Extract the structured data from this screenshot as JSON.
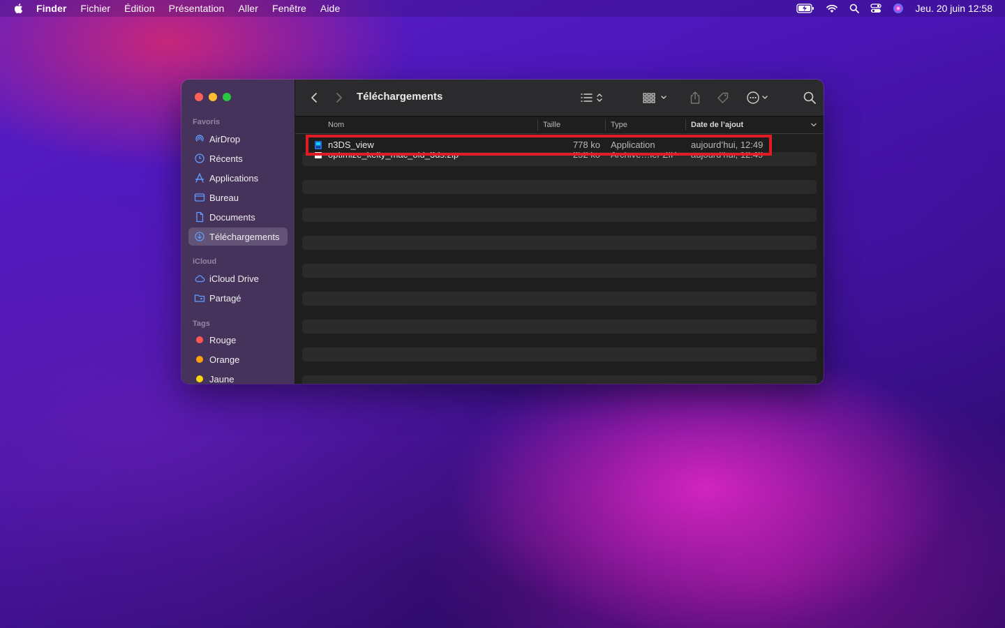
{
  "menubar": {
    "app": "Finder",
    "menus": [
      "Fichier",
      "Édition",
      "Présentation",
      "Aller",
      "Fenêtre",
      "Aide"
    ],
    "clock": "Jeu. 20 juin  12:58"
  },
  "window": {
    "title": "Téléchargements",
    "sidebar": {
      "favorites_label": "Favoris",
      "favorites": [
        {
          "label": "AirDrop",
          "icon": "airdrop-icon"
        },
        {
          "label": "Récents",
          "icon": "clock-icon"
        },
        {
          "label": "Applications",
          "icon": "applications-icon"
        },
        {
          "label": "Bureau",
          "icon": "desktop-icon"
        },
        {
          "label": "Documents",
          "icon": "document-icon"
        },
        {
          "label": "Téléchargements",
          "icon": "download-icon",
          "selected": true
        }
      ],
      "icloud_label": "iCloud",
      "icloud": [
        {
          "label": "iCloud Drive",
          "icon": "cloud-icon"
        },
        {
          "label": "Partagé",
          "icon": "shared-folder-icon"
        }
      ],
      "tags_label": "Tags",
      "tags": [
        {
          "label": "Rouge",
          "color": "#ff5a50"
        },
        {
          "label": "Orange",
          "color": "#ff9f0a"
        },
        {
          "label": "Jaune",
          "color": "#ffd60a"
        }
      ]
    },
    "columns": {
      "name": "Nom",
      "size": "Taille",
      "type": "Type",
      "date": "Date de l’ajout"
    },
    "files": [
      {
        "name": "n3DS_view",
        "size": "778 ko",
        "type": "Application",
        "date": "aujourd’hui, 12:49"
      },
      {
        "name": "optimize_kelty_mac_old_3ds.zip",
        "size": "252 ko",
        "type": "Archive…ier ZIP",
        "date": "aujourd’hui, 12:49"
      }
    ]
  },
  "colors": {
    "highlight": "#e01c24",
    "accent": "#5e9dff"
  }
}
